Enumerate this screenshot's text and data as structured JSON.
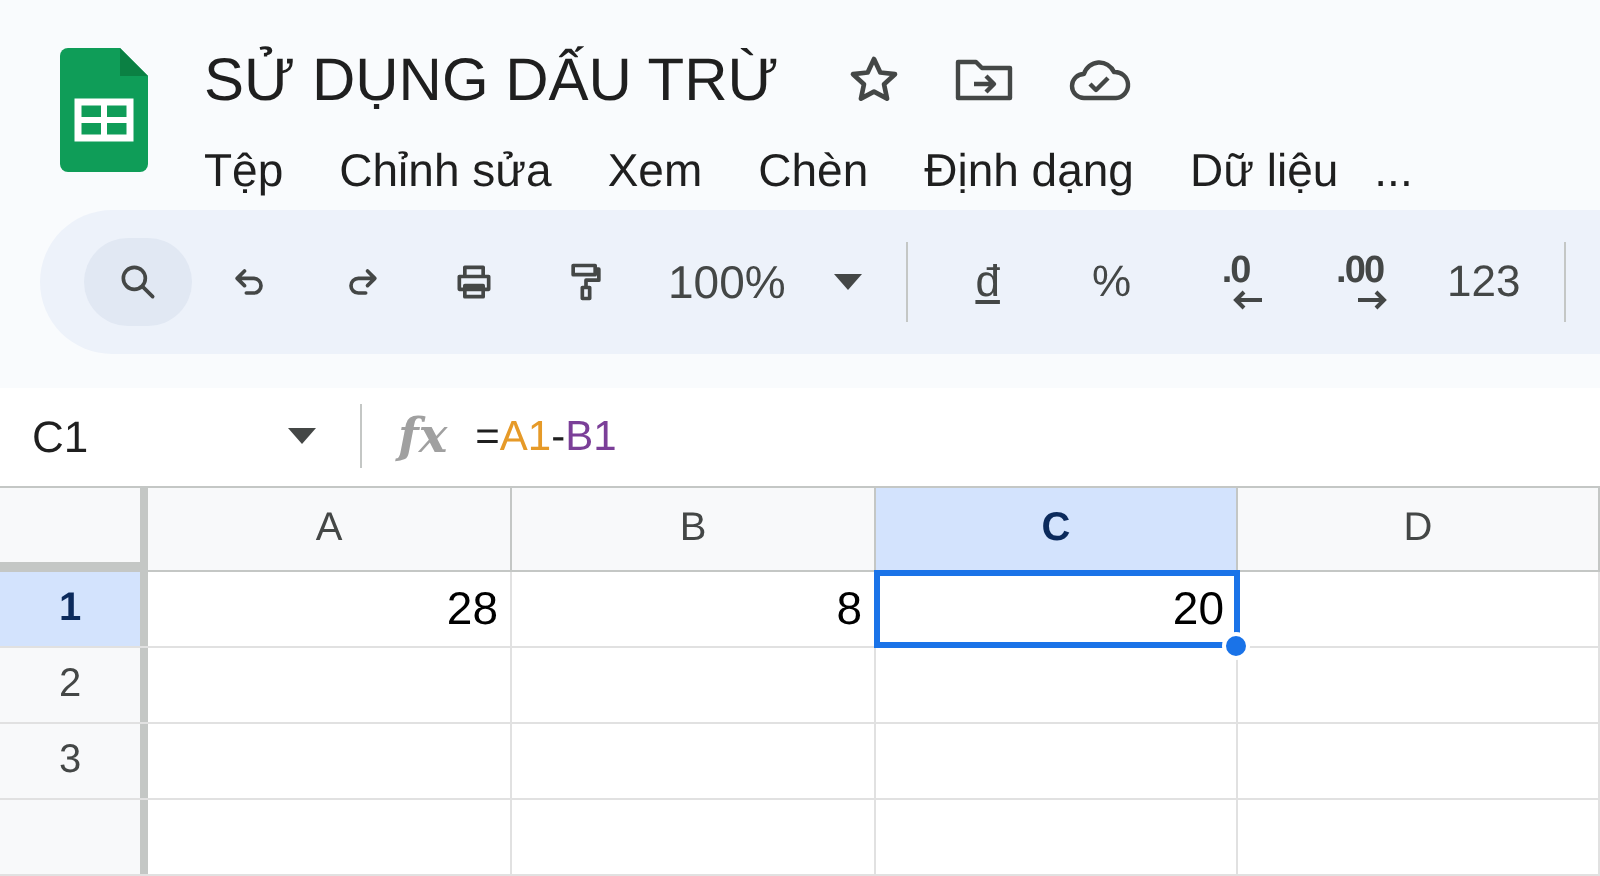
{
  "document": {
    "title": "SỬ DỤNG DẤU TRỪ"
  },
  "menu": [
    "Tệp",
    "Chỉnh sửa",
    "Xem",
    "Chèn",
    "Định dạng",
    "Dữ liệu",
    "..."
  ],
  "toolbar": [
    {
      "kind": "search",
      "selected": true
    },
    {
      "kind": "undo",
      "selected": false
    },
    {
      "kind": "redo",
      "selected": false
    },
    {
      "kind": "print",
      "selected": false
    },
    {
      "kind": "paint",
      "selected": false
    },
    {
      "kind": "zoom",
      "label": "100%",
      "selected": false
    },
    {
      "kind": "divider"
    },
    {
      "kind": "text",
      "label": "đ",
      "underline": true,
      "selected": false
    },
    {
      "kind": "text",
      "label": "%",
      "underline": false,
      "selected": false
    },
    {
      "kind": "decimal-less",
      "label": ".0",
      "selected": false
    },
    {
      "kind": "decimal-more",
      "label": ".00",
      "selected": false
    },
    {
      "kind": "text",
      "label": "123",
      "underline": false,
      "selected": false
    },
    {
      "kind": "divider"
    }
  ],
  "formula_bar": {
    "cell_ref": "C1",
    "fx": "fx",
    "formula": [
      {
        "text": "=",
        "color": "#1f1f1f"
      },
      {
        "text": "A1",
        "color": "#e69a28"
      },
      {
        "text": "-",
        "color": "#1f1f1f"
      },
      {
        "text": "B1",
        "color": "#7b3f98"
      }
    ]
  },
  "grid": {
    "columns": [
      {
        "label": "A",
        "selected": false
      },
      {
        "label": "B",
        "selected": false
      },
      {
        "label": "C",
        "selected": true
      },
      {
        "label": "D",
        "selected": false
      }
    ],
    "rows": [
      {
        "label": "1",
        "selected": true,
        "cells": [
          {
            "value": "28",
            "selected": false
          },
          {
            "value": "8",
            "selected": false
          },
          {
            "value": "20",
            "selected": true
          },
          {
            "selected": false
          }
        ]
      },
      {
        "label": "2",
        "selected": false,
        "cells": []
      },
      {
        "label": "3",
        "selected": false,
        "cells": []
      },
      {
        "label": "",
        "selected": false,
        "cells": []
      }
    ]
  }
}
